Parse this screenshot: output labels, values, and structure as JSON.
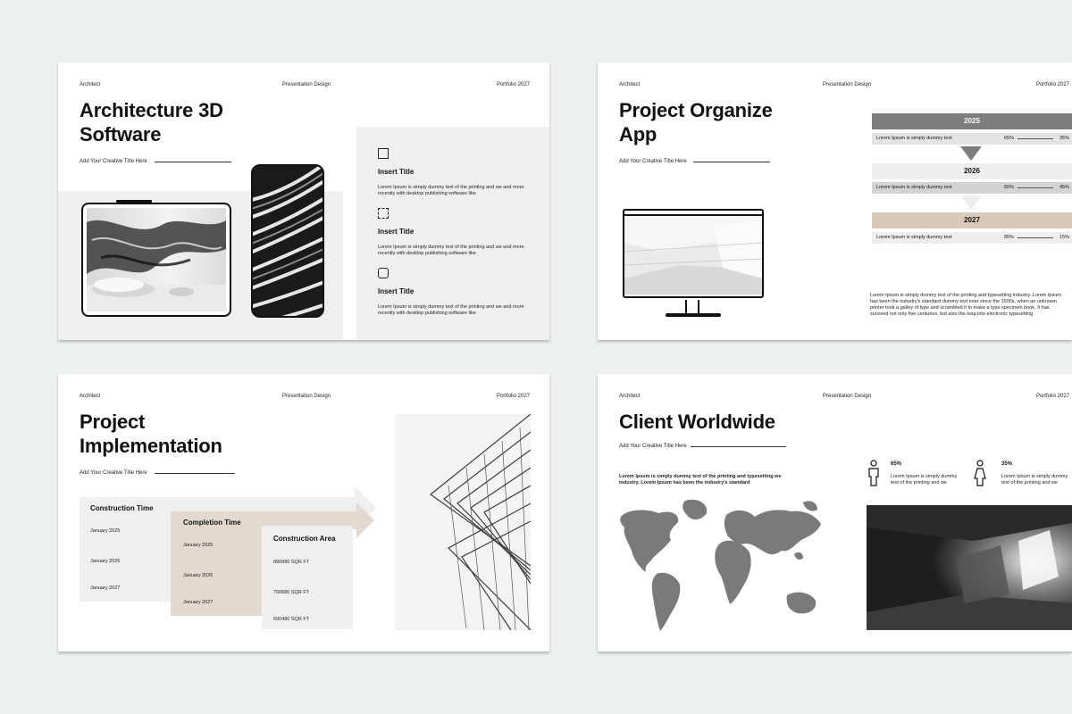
{
  "header": {
    "left": "Architect",
    "mid": "Presentation Design",
    "right": "Portfolio 2027"
  },
  "slide1": {
    "title_line1": "Architecture 3D",
    "title_line2": "Software",
    "subtitle": "Add Your Creative Title Here",
    "items": [
      {
        "icon": "monitor-icon",
        "title": "Insert Title",
        "text1": "Lorem Ipsum is simply dummy text of the printing and we and more",
        "text2": "recently with desktop publishing software like"
      },
      {
        "icon": "pattern-icon",
        "title": "Insert Title",
        "text1": "Lorem Ipsum is simply dummy text of the printing and we and more",
        "text2": "recently with desktop publishing software like"
      },
      {
        "icon": "device-icon",
        "title": "Insert Title",
        "text1": "Lorem Ipsum is simply dummy text of the printing and we and more",
        "text2": "recently with desktop publishing software like"
      }
    ]
  },
  "slide2": {
    "title_line1": "Project Organize",
    "title_line2": "App",
    "subtitle": "Add Your Creative Title Here",
    "timeline": [
      {
        "year": "2025",
        "text": "Lorem Ipsum is simply dummy text",
        "a": "65%",
        "b": "35%",
        "header_color": "#7d7d7d",
        "row_color": "#e4e4e4"
      },
      {
        "year": "2026",
        "text": "Lorem Ipsum is simply dummy text",
        "a": "55%",
        "b": "45%",
        "header_color": "#eeeeee",
        "row_color": "#d3d3d3"
      },
      {
        "year": "2027",
        "text": "Lorem Ipsum is simply dummy text",
        "a": "85%",
        "b": "15%",
        "header_color": "#d8c9b9",
        "row_color": "#eeeeee"
      }
    ],
    "paragraph": [
      "Lorem Ipsum is simply dummy text of the printing and typesetting industry. Lorem Ipsum",
      "has been the industry's standard dummy text ever since the 1500s, when an unknown",
      "printer took a galley of type and scrambled it to make a type specimen book. It has",
      "survived not only five centuries, but also the leap into electronic typesetting"
    ]
  },
  "slide3": {
    "title_line1": "Project",
    "title_line2": "Implementation",
    "subtitle": "Add Your Creative Title Here",
    "columns": [
      {
        "title": "Construction Time",
        "rows": [
          "January 2025",
          "January 2026",
          "January 2027"
        ],
        "color": "#f0eff0"
      },
      {
        "title": "Completion Time",
        "rows": [
          "January 2025",
          "January 2026",
          "January 2027"
        ],
        "color": "#e3d9ce"
      },
      {
        "title": "Construction Area",
        "rows": [
          "890980 SQR FT",
          "790680 SQR FT",
          "590480 SQR FT"
        ],
        "color": "#f0eff0"
      }
    ]
  },
  "slide4": {
    "title": "Client Worldwide",
    "subtitle": "Add Your Creative Title Here",
    "lead1": "Lorem Ipsum is simply dummy text of the printing and typesetting we",
    "lead2": "industry. Lorem Ipsum has been the industry's standard",
    "stats": [
      {
        "icon": "male-person-icon",
        "pct": "65%",
        "text1": "Lorem Ipsum is simply dummy",
        "text2": "text of the printing and we"
      },
      {
        "icon": "female-person-icon",
        "pct": "35%",
        "text1": "Lorem Ipsum is simply dummy",
        "text2": "text of the printing and we"
      }
    ]
  }
}
